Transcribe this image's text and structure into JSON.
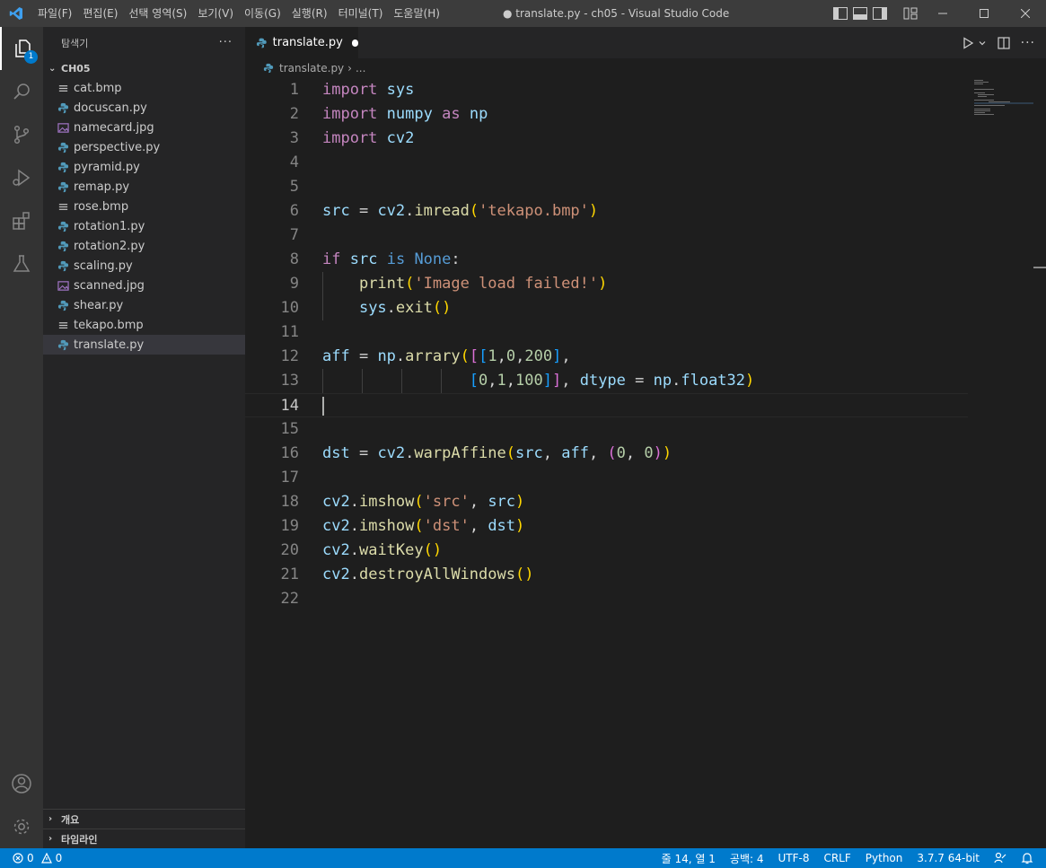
{
  "titlebar": {
    "menus": [
      "파일(F)",
      "편집(E)",
      "선택 영역(S)",
      "보기(V)",
      "이동(G)",
      "실행(R)",
      "터미널(T)",
      "도움말(H)"
    ],
    "window_title": "● translate.py - ch05 - Visual Studio Code"
  },
  "activity": {
    "explorer_badge": "1"
  },
  "sidebar": {
    "title": "탐색기",
    "more": "···",
    "folder": "CH05",
    "files": [
      {
        "name": "cat.bmp",
        "type": "image-bmp"
      },
      {
        "name": "docuscan.py",
        "type": "python"
      },
      {
        "name": "namecard.jpg",
        "type": "image"
      },
      {
        "name": "perspective.py",
        "type": "python"
      },
      {
        "name": "pyramid.py",
        "type": "python"
      },
      {
        "name": "remap.py",
        "type": "python"
      },
      {
        "name": "rose.bmp",
        "type": "image-bmp"
      },
      {
        "name": "rotation1.py",
        "type": "python"
      },
      {
        "name": "rotation2.py",
        "type": "python"
      },
      {
        "name": "scaling.py",
        "type": "python"
      },
      {
        "name": "scanned.jpg",
        "type": "image"
      },
      {
        "name": "shear.py",
        "type": "python"
      },
      {
        "name": "tekapo.bmp",
        "type": "image-bmp"
      },
      {
        "name": "translate.py",
        "type": "python",
        "selected": true
      }
    ],
    "outline_label": "개요",
    "timeline_label": "타임라인"
  },
  "editor": {
    "tab_label": "translate.py",
    "breadcrumb_file": "translate.py",
    "breadcrumb_more": "...",
    "line_numbers": [
      "1",
      "2",
      "3",
      "4",
      "5",
      "6",
      "7",
      "8",
      "9",
      "10",
      "11",
      "12",
      "13",
      "14",
      "15",
      "16",
      "17",
      "18",
      "19",
      "20",
      "21",
      "22"
    ],
    "current_line": 14
  },
  "statusbar": {
    "errors": "0",
    "warnings": "0",
    "position": "줄 14, 열 1",
    "spaces": "공백: 4",
    "encoding": "UTF-8",
    "eol": "CRLF",
    "language": "Python",
    "interpreter": "3.7.7 64-bit"
  },
  "colors": {
    "accent": "#007acc",
    "keyword": "#c586c0",
    "function": "#dcdcaa",
    "variable": "#9cdcfe",
    "string": "#ce9178",
    "number": "#b5cea8",
    "constant": "#569cd6"
  }
}
